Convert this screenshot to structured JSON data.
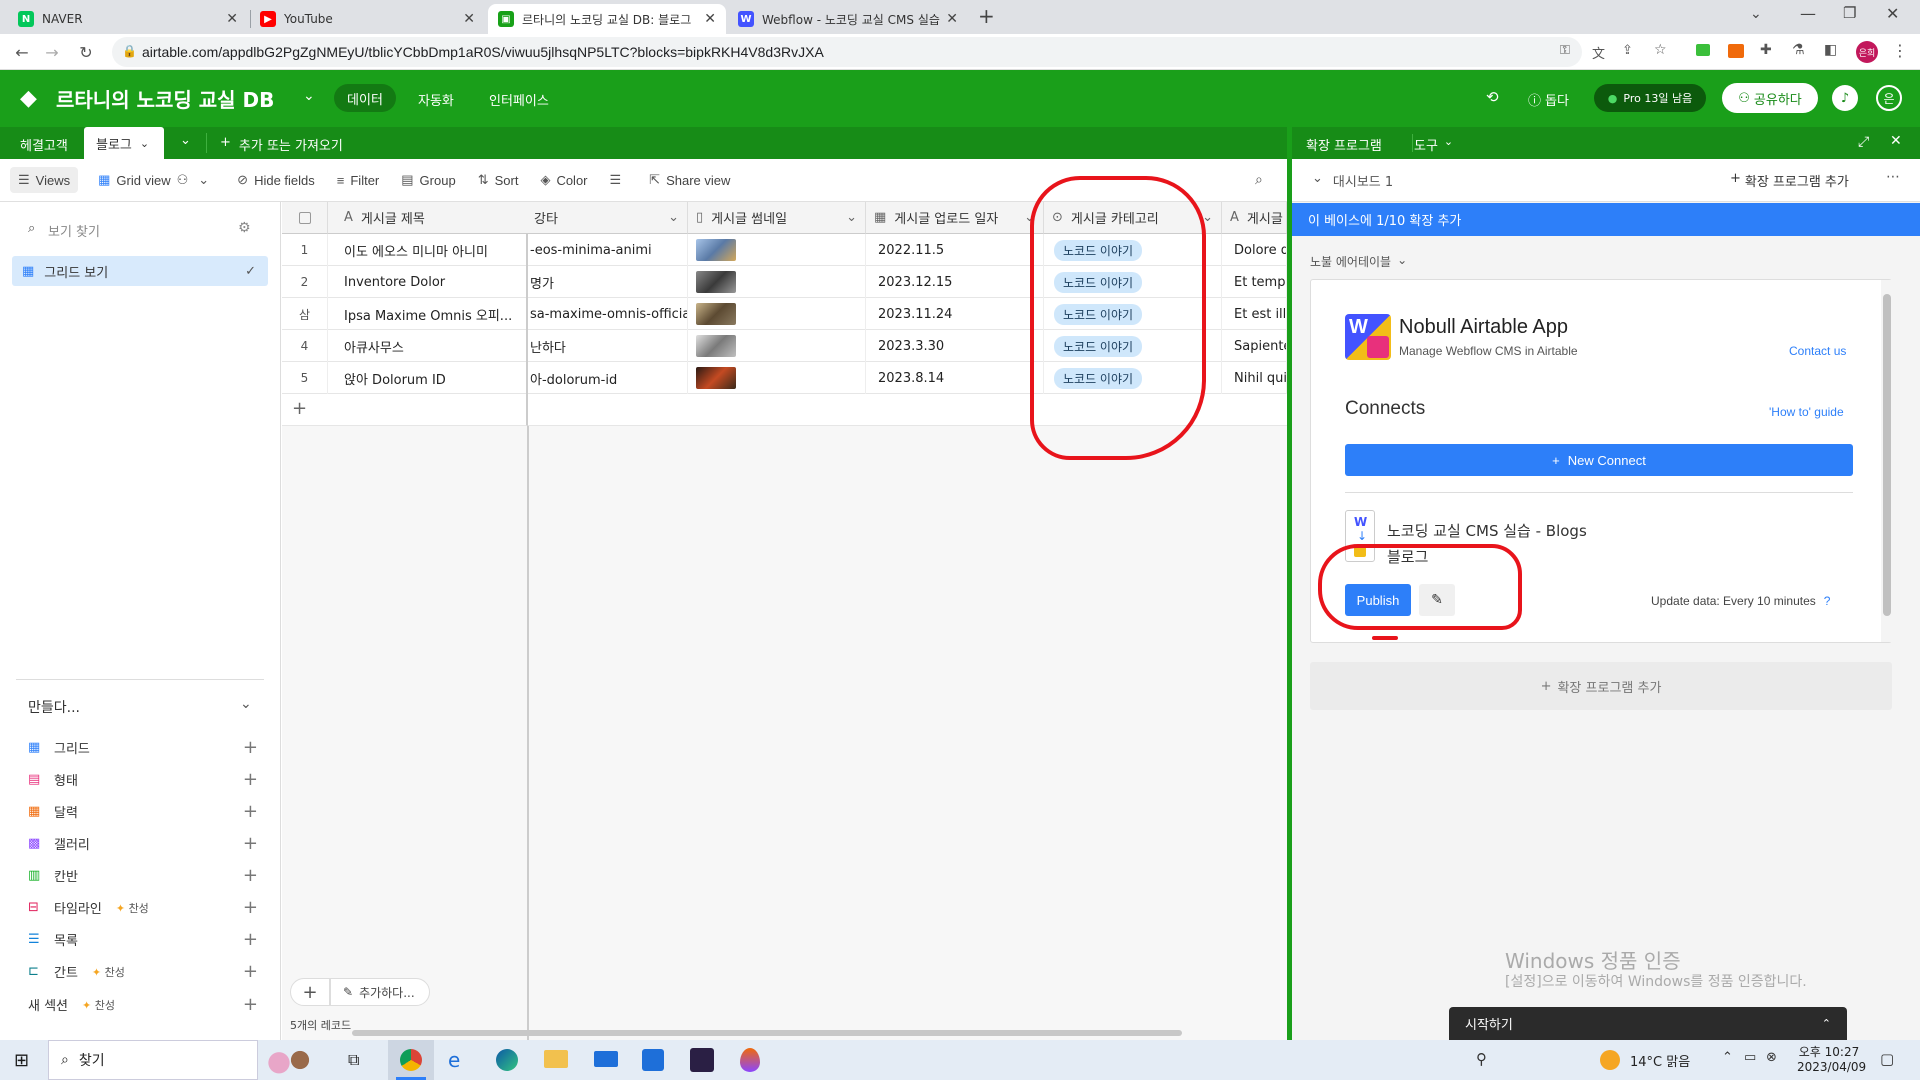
{
  "browser": {
    "tabs": [
      {
        "title": "NAVER",
        "icon": "naver-icon",
        "color": "#03c75a"
      },
      {
        "title": "YouTube",
        "icon": "youtube-icon",
        "color": "#ff0000"
      },
      {
        "title": "르타니의 노코딩 교실 DB: 블로그",
        "icon": "airtable-icon",
        "color": "#18a118"
      },
      {
        "title": "Webflow - 노코딩 교실 CMS 실습",
        "icon": "webflow-icon",
        "color": "#4353ff"
      }
    ],
    "url": "airtable.com/appdlbG2PgZgNMEyU/tblicYCbbDmp1aR0S/viwuu5jlhsqNP5LTC?blocks=bipkRKH4V8d3RvJXA",
    "profile_initials": "은희"
  },
  "header": {
    "base_name": "르타니의 노코딩 교실 DB",
    "nav": [
      "데이터",
      "자동화",
      "인터페이스"
    ],
    "help": "돕다",
    "trial": "Pro 13일 남음",
    "share": "공유하다",
    "avatar": "은"
  },
  "table_tabs": {
    "items": [
      "헤결고객",
      "블로그"
    ],
    "add": "추가 또는 가져오기"
  },
  "toolbar": {
    "views": "Views",
    "grid_view": "Grid view",
    "hide_fields": "Hide fields",
    "filter": "Filter",
    "group": "Group",
    "sort": "Sort",
    "color": "Color",
    "share_view": "Share view"
  },
  "sidebar": {
    "search_placeholder": "보기 찾기",
    "active_view": "그리드 보기",
    "create_label": "만들다...",
    "create_items": [
      {
        "label": "그리드",
        "icon": "grid-icon",
        "color": "#2d7ff9",
        "badge": ""
      },
      {
        "label": "형태",
        "icon": "form-icon",
        "color": "#e8307c",
        "badge": ""
      },
      {
        "label": "달력",
        "icon": "calendar-icon",
        "color": "#f06a0b",
        "badge": ""
      },
      {
        "label": "갤러리",
        "icon": "gallery-icon",
        "color": "#8b46ff",
        "badge": ""
      },
      {
        "label": "칸반",
        "icon": "kanban-icon",
        "color": "#11af22",
        "badge": ""
      },
      {
        "label": "타임라인",
        "icon": "timeline-icon",
        "color": "#e01e5a",
        "badge": "찬성"
      },
      {
        "label": "목록",
        "icon": "list-icon",
        "color": "#1283da",
        "badge": ""
      },
      {
        "label": "간트",
        "icon": "gantt-icon",
        "color": "#0d7f8c",
        "badge": "찬성"
      },
      {
        "label": "새 섹션",
        "icon": "",
        "color": "#333",
        "badge": "찬성"
      }
    ],
    "add_record": "추가하다...",
    "record_count": "5개의 레코드"
  },
  "grid": {
    "columns": [
      "게시글 제목",
      "강타",
      "게시글 썸네일",
      "게시글 업로드 일자",
      "게시글 카테고리",
      "게시글"
    ],
    "rows": [
      {
        "num": "1",
        "title": "이도 에오스 미니마 아니미",
        "slug": "-eos-minima-animi",
        "thumb_color": "#6d8fb8",
        "date": "2022.11.5",
        "category": "노코드 이야기",
        "body": "Dolore q"
      },
      {
        "num": "2",
        "title": "Inventore Dolor",
        "slug": "명가",
        "thumb_color": "#5a5a5a",
        "date": "2023.12.15",
        "category": "노코드 이야기",
        "body": "Et tempo"
      },
      {
        "num": "삼",
        "title": "Ipsa Maxime Omnis 오피...",
        "slug": "sa-maxime-omnis-officia",
        "thumb_color": "#7a6a55",
        "date": "2023.11.24",
        "category": "노코드 이야기",
        "body": "Et est illu"
      },
      {
        "num": "4",
        "title": "아큐사무스",
        "slug": "난하다",
        "thumb_color": "#9a9a9a",
        "date": "2023.3.30",
        "category": "노코드 이야기",
        "body": "Sapiente"
      },
      {
        "num": "5",
        "title": "앉아 Dolorum ID",
        "slug": "아-dolorum-id",
        "thumb_color": "#b54a2a",
        "date": "2023.8.14",
        "category": "노코드 이야기",
        "body": "Nihil qui"
      }
    ]
  },
  "extension": {
    "title": "확장 프로그램",
    "tools": "도구",
    "dashboard": "대시보드 1",
    "add_extension": "확장 프로그램 추가",
    "banner": "이 베이스에 1/10 확장 추가",
    "sub_title": "노불 에어테이블",
    "app_name": "Nobull Airtable App",
    "app_sub": "Manage Webflow CMS in Airtable",
    "contact": "Contact us",
    "connects": "Connects",
    "guide": "'How to' guide",
    "new_connect": "New Connect",
    "connect_name": "노코딩 교실 CMS 실습 - Blogs",
    "connect_table": "블로그",
    "publish": "Publish",
    "update": "Update data: Every 10 minutes",
    "help": "?",
    "bottom_add": "확장 프로그램 추가",
    "watermark_title": "Windows 정품 인증",
    "watermark_sub": "[설정]으로 이동하여 Windows를 정품 인증합니다.",
    "start_popup": "시작하기"
  },
  "taskbar": {
    "search": "찾기",
    "weather": "14°C 맑음",
    "time": "오후 10:27",
    "date": "2023/04/09"
  }
}
